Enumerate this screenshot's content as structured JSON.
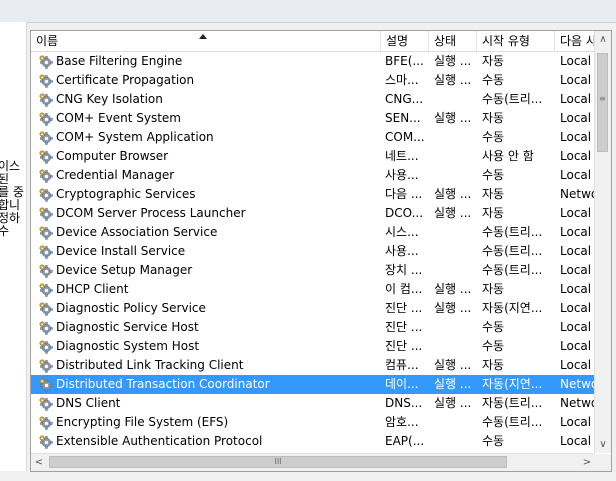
{
  "left_pane": {
    "text": "이스\n된\n를 중\n합니\n정하\n수"
  },
  "columns": {
    "name": "이름",
    "description": "설명",
    "status": "상태",
    "startup": "시작 유형",
    "logon": "다음 사"
  },
  "selected_index": 17,
  "rows": [
    {
      "name": "Base Filtering Engine",
      "description": "BFE(...",
      "status": "실행 ...",
      "startup": "자동",
      "logon": "Local S"
    },
    {
      "name": "Certificate Propagation",
      "description": "스마...",
      "status": "실행 ...",
      "startup": "수동",
      "logon": "Local S"
    },
    {
      "name": "CNG Key Isolation",
      "description": "CNG...",
      "status": "",
      "startup": "수동(트리...",
      "logon": "Local S"
    },
    {
      "name": "COM+ Event System",
      "description": "SEN...",
      "status": "실행 ...",
      "startup": "자동",
      "logon": "Local S"
    },
    {
      "name": "COM+ System Application",
      "description": "COM...",
      "status": "",
      "startup": "수동",
      "logon": "Local S"
    },
    {
      "name": "Computer Browser",
      "description": "네트...",
      "status": "",
      "startup": "사용 안 함",
      "logon": "Local S"
    },
    {
      "name": "Credential Manager",
      "description": "사용...",
      "status": "",
      "startup": "수동",
      "logon": "Local S"
    },
    {
      "name": "Cryptographic Services",
      "description": "다음 ...",
      "status": "실행 ...",
      "startup": "자동",
      "logon": "Netwo"
    },
    {
      "name": "DCOM Server Process Launcher",
      "description": "DCO...",
      "status": "실행 ...",
      "startup": "자동",
      "logon": "Local S"
    },
    {
      "name": "Device Association Service",
      "description": "시스...",
      "status": "",
      "startup": "수동(트리...",
      "logon": "Local S"
    },
    {
      "name": "Device Install Service",
      "description": "사용...",
      "status": "",
      "startup": "수동(트리...",
      "logon": "Local S"
    },
    {
      "name": "Device Setup Manager",
      "description": "장치 ...",
      "status": "",
      "startup": "수동(트리...",
      "logon": "Local S"
    },
    {
      "name": "DHCP Client",
      "description": "이 컴...",
      "status": "실행 ...",
      "startup": "자동",
      "logon": "Local S"
    },
    {
      "name": "Diagnostic Policy Service",
      "description": "진단 ...",
      "status": "실행 ...",
      "startup": "자동(지연...",
      "logon": "Local S"
    },
    {
      "name": "Diagnostic Service Host",
      "description": "진단 ...",
      "status": "",
      "startup": "수동",
      "logon": "Local S"
    },
    {
      "name": "Diagnostic System Host",
      "description": "진단 ...",
      "status": "",
      "startup": "수동",
      "logon": "Local S"
    },
    {
      "name": "Distributed Link Tracking Client",
      "description": "컴퓨...",
      "status": "실행 ...",
      "startup": "자동",
      "logon": "Local S"
    },
    {
      "name": "Distributed Transaction Coordinator",
      "description": "데이...",
      "status": "실행 ...",
      "startup": "자동(지연...",
      "logon": "Netwo"
    },
    {
      "name": "DNS Client",
      "description": "DNS...",
      "status": "실행 ...",
      "startup": "자동(트리...",
      "logon": "Netwo"
    },
    {
      "name": "Encrypting File System (EFS)",
      "description": "암호...",
      "status": "",
      "startup": "수동(트리...",
      "logon": "Local S"
    },
    {
      "name": "Extensible Authentication Protocol",
      "description": "EAP(...",
      "status": "",
      "startup": "수동",
      "logon": "Local S"
    }
  ],
  "scroll": {
    "up": "∧",
    "down": "∨",
    "left": "<",
    "right": ">",
    "grip_v": "≡",
    "grip_h": "III"
  },
  "icons": {
    "row_icon": "gear-service-icon"
  },
  "colors": {
    "selection": "#3399ff"
  }
}
